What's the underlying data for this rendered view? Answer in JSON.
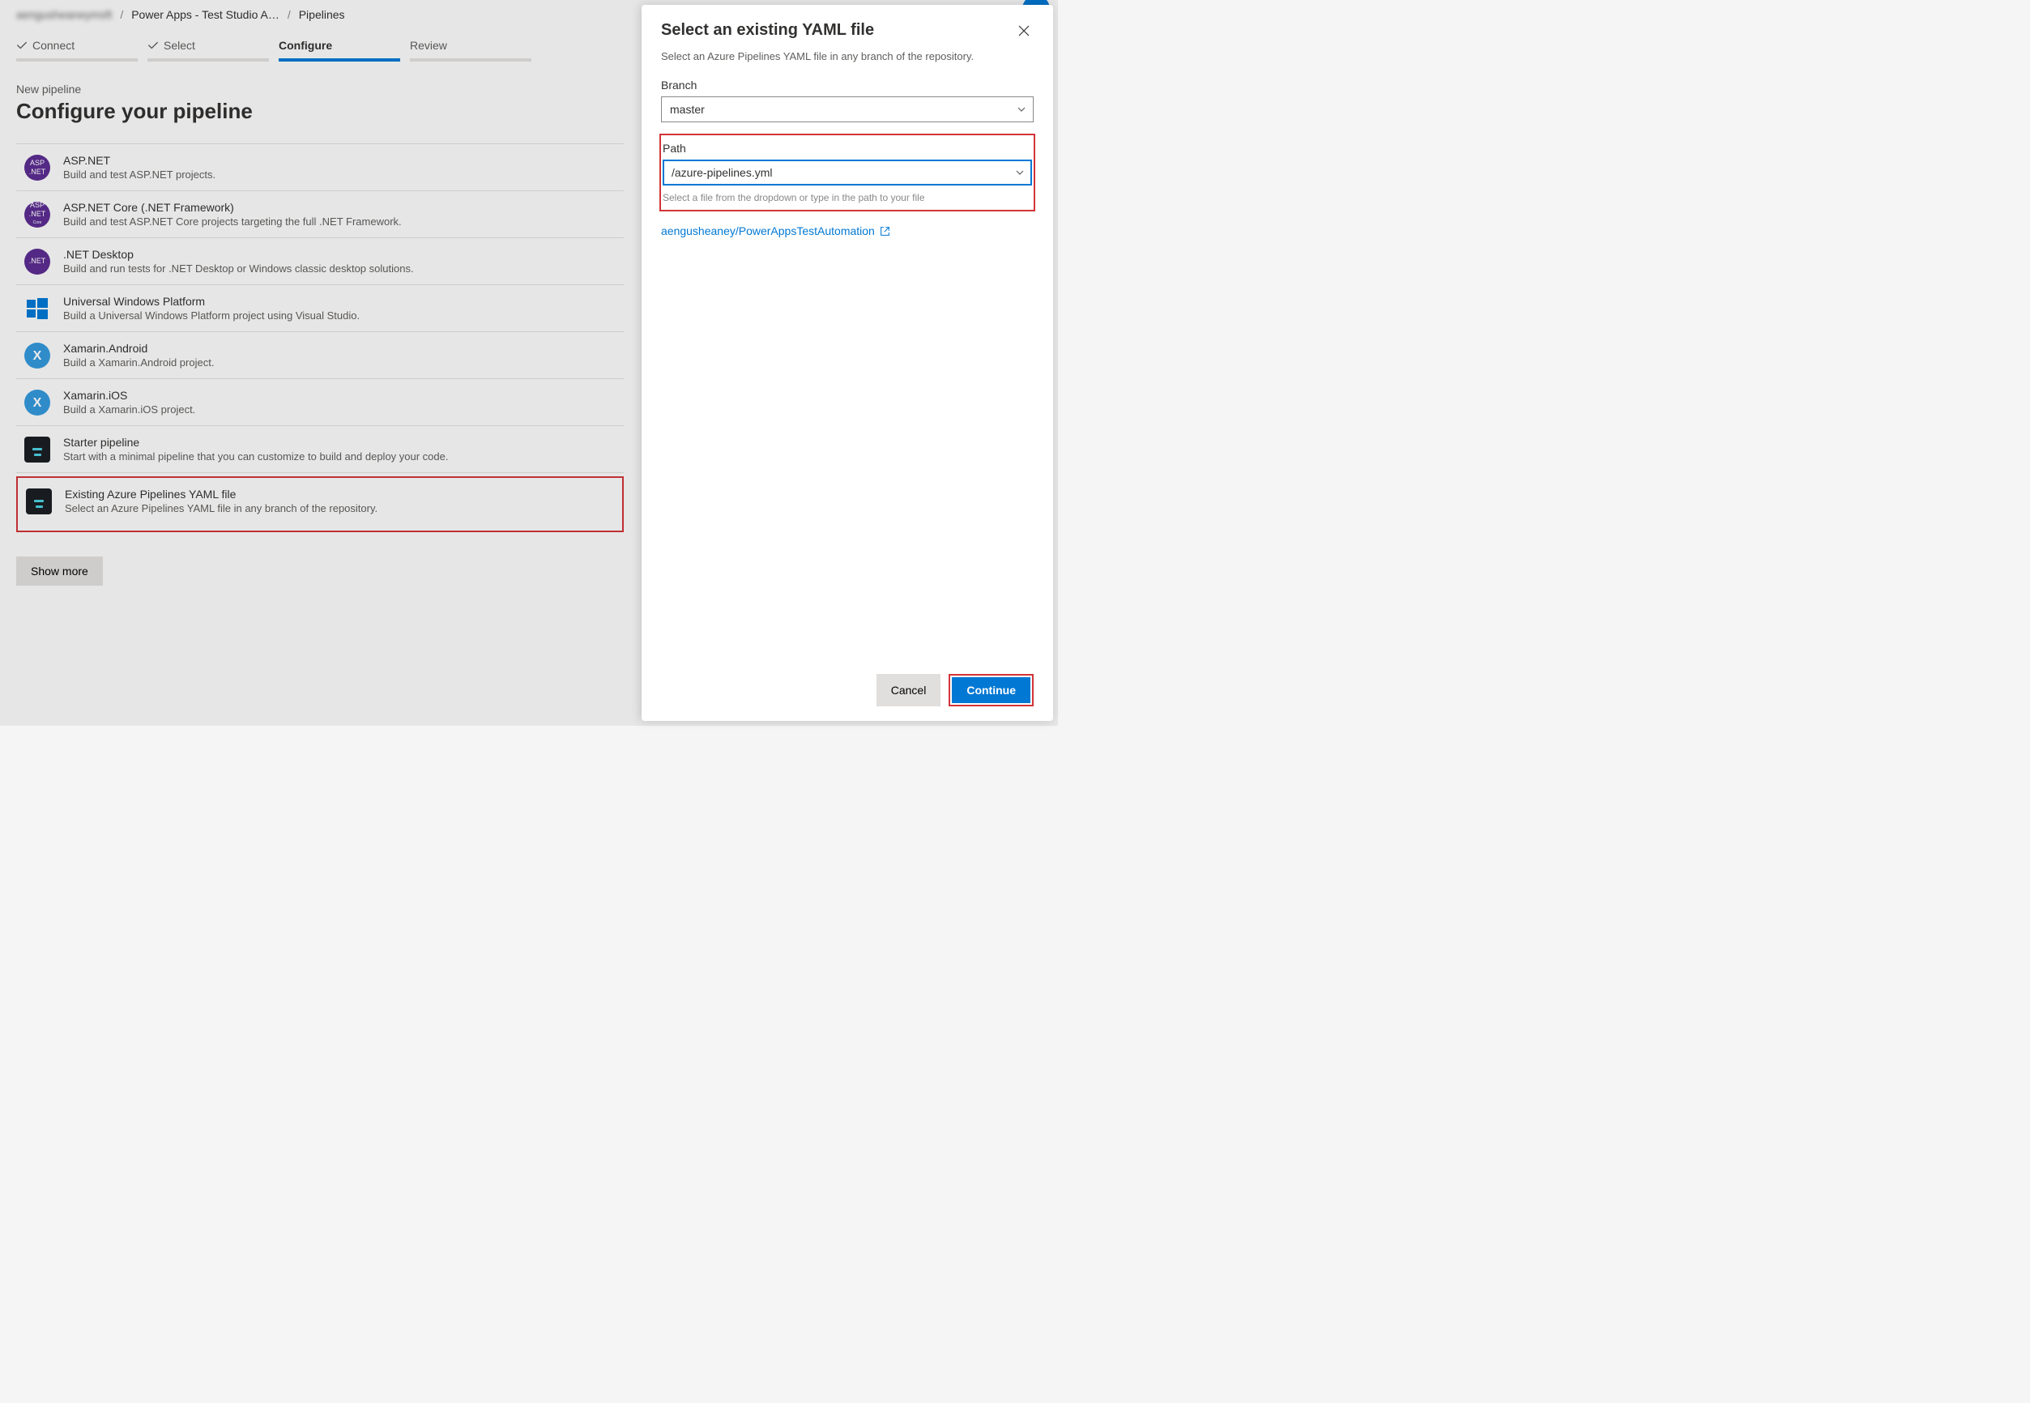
{
  "breadcrumb": {
    "org": "aengusheaneymsft",
    "project": "Power Apps - Test Studio A…",
    "section": "Pipelines"
  },
  "steps": {
    "connect": "Connect",
    "select": "Select",
    "configure": "Configure",
    "review": "Review"
  },
  "page": {
    "eyebrow": "New pipeline",
    "title": "Configure your pipeline",
    "show_more": "Show more"
  },
  "options": [
    {
      "title": "ASP.NET",
      "desc": "Build and test ASP.NET projects.",
      "icon": "aspnet"
    },
    {
      "title": "ASP.NET Core (.NET Framework)",
      "desc": "Build and test ASP.NET Core projects targeting the full .NET Framework.",
      "icon": "aspnet-core"
    },
    {
      "title": ".NET Desktop",
      "desc": "Build and run tests for .NET Desktop or Windows classic desktop solutions.",
      "icon": "dotnet"
    },
    {
      "title": "Universal Windows Platform",
      "desc": "Build a Universal Windows Platform project using Visual Studio.",
      "icon": "windows"
    },
    {
      "title": "Xamarin.Android",
      "desc": "Build a Xamarin.Android project.",
      "icon": "xamarin"
    },
    {
      "title": "Xamarin.iOS",
      "desc": "Build a Xamarin.iOS project.",
      "icon": "xamarin"
    },
    {
      "title": "Starter pipeline",
      "desc": "Start with a minimal pipeline that you can customize to build and deploy your code.",
      "icon": "yaml"
    },
    {
      "title": "Existing Azure Pipelines YAML file",
      "desc": "Select an Azure Pipelines YAML file in any branch of the repository.",
      "icon": "yaml"
    }
  ],
  "panel": {
    "title": "Select an existing YAML file",
    "subtitle": "Select an Azure Pipelines YAML file in any branch of the repository.",
    "branch_label": "Branch",
    "branch_value": "master",
    "path_label": "Path",
    "path_value": "/azure-pipelines.yml",
    "path_helper": "Select a file from the dropdown or type in the path to your file",
    "repo_link": "aengusheaney/PowerAppsTestAutomation",
    "cancel": "Cancel",
    "continue": "Continue"
  }
}
